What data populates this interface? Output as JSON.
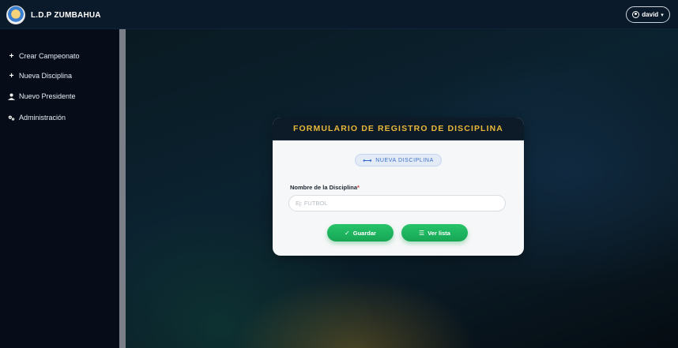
{
  "header": {
    "brand": "L.D.P ZUMBAHUA",
    "user": "david"
  },
  "sidebar": {
    "items": [
      {
        "icon": "plus-icon",
        "glyph": "+",
        "label": "Crear Campeonato"
      },
      {
        "icon": "plus-icon",
        "glyph": "+",
        "label": "Nueva Disciplina"
      },
      {
        "icon": "user-icon",
        "glyph": "👤",
        "label": "Nuevo Presidente"
      },
      {
        "icon": "gears-icon",
        "glyph": "⚙",
        "label": "Administración"
      }
    ]
  },
  "form": {
    "title": "FORMULARIO DE REGISTRO DE DISCIPLINA",
    "badge": "NUEVA DISCIPLINA",
    "field_label": "Nombre de la Disciplina",
    "required_mark": "*",
    "placeholder": "Ej: FUTBOL",
    "save_label": "Guardar",
    "list_label": "Ver lista"
  },
  "colors": {
    "accent": "#e8b83a",
    "button": "#1fb860",
    "badge": "#3c6fc7"
  }
}
